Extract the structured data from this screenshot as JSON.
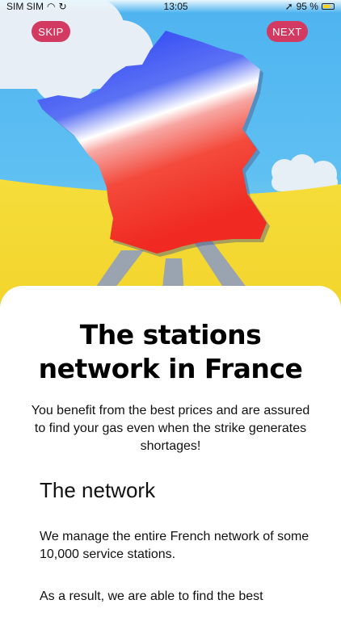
{
  "status_bar": {
    "carrier": "SIM SIM",
    "time": "13:05",
    "battery": "95 %",
    "icons": [
      "wifi-icon",
      "sync-icon",
      "location-icon",
      "battery-icon"
    ]
  },
  "onboarding": {
    "skip_label": "SKIP",
    "next_label": "NEXT",
    "title_line1": "The stations",
    "title_line2": "network in France",
    "intro": "You benefit from the best prices and are assured to find your gas even when the strike generates shortages!",
    "section_heading": "The network",
    "paragraphs": [
      "We manage the entire French network of some 10,000 service stations.",
      "As a result, we are able to find the best"
    ]
  },
  "colors": {
    "accent": "#d23a62",
    "sky": "#5bbdf1",
    "ground": "#f6dc35",
    "france_blue": "#2a3ff5",
    "france_red": "#f0302a"
  }
}
